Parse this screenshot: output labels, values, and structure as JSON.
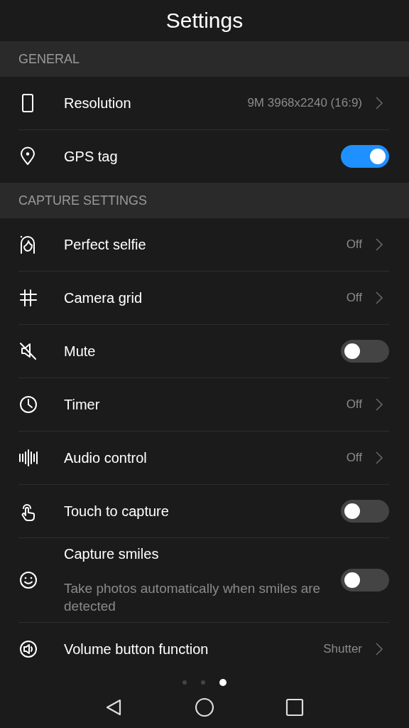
{
  "title": "Settings",
  "sections": [
    {
      "header": "GENERAL",
      "items": [
        {
          "kind": "link",
          "label": "Resolution",
          "value": "9M 3968x2240 (16:9)"
        },
        {
          "kind": "toggle",
          "label": "GPS tag",
          "on": true
        }
      ]
    },
    {
      "header": "CAPTURE SETTINGS",
      "items": [
        {
          "kind": "link",
          "label": "Perfect selfie",
          "value": "Off"
        },
        {
          "kind": "link",
          "label": "Camera grid",
          "value": "Off"
        },
        {
          "kind": "toggle",
          "label": "Mute",
          "on": false
        },
        {
          "kind": "link",
          "label": "Timer",
          "value": "Off"
        },
        {
          "kind": "link",
          "label": "Audio control",
          "value": "Off"
        },
        {
          "kind": "toggle",
          "label": "Touch to capture",
          "on": false
        },
        {
          "kind": "toggle",
          "label": "Capture smiles",
          "description": "Take photos automatically when smiles are detected",
          "on": false
        },
        {
          "kind": "link",
          "label": "Volume button function",
          "value": "Shutter"
        }
      ]
    }
  ],
  "pages": [
    {
      "selected": false
    },
    {
      "selected": false
    },
    {
      "selected": true
    }
  ]
}
